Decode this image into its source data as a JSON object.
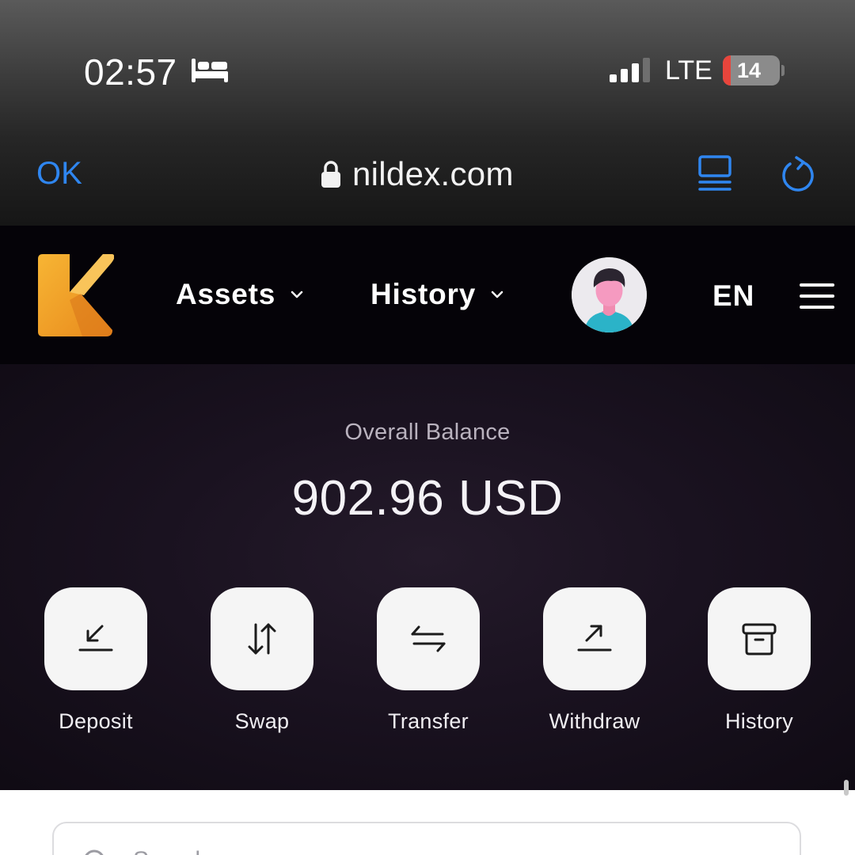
{
  "status_bar": {
    "time": "02:57",
    "network": "LTE",
    "battery_level": "14",
    "battery_fraction": 0.14,
    "icons": [
      "bed-icon",
      "signal-icon",
      "battery-icon"
    ]
  },
  "browser": {
    "done_label": "OK",
    "url": "nildex.com",
    "icons": [
      "lock-icon",
      "reader-icon",
      "reload-icon"
    ]
  },
  "header": {
    "nav": [
      {
        "label": "Assets",
        "icon": "chevron-down-icon"
      },
      {
        "label": "History",
        "icon": "chevron-down-icon"
      }
    ],
    "language": "EN",
    "icons": [
      "logo",
      "avatar",
      "menu-icon"
    ]
  },
  "balance": {
    "label": "Overall Balance",
    "value": "902.96 USD"
  },
  "actions": [
    {
      "label": "Deposit",
      "icon": "deposit-icon"
    },
    {
      "label": "Swap",
      "icon": "swap-icon"
    },
    {
      "label": "Transfer",
      "icon": "transfer-icon"
    },
    {
      "label": "Withdraw",
      "icon": "withdraw-icon"
    },
    {
      "label": "History",
      "icon": "history-box-icon"
    }
  ],
  "search": {
    "placeholder": "Search"
  },
  "colors": {
    "ios_link": "#2f86f0",
    "brand_orange": "#f3a32a",
    "battery_low": "#e8453c",
    "tile_bg": "#f5f5f5"
  }
}
